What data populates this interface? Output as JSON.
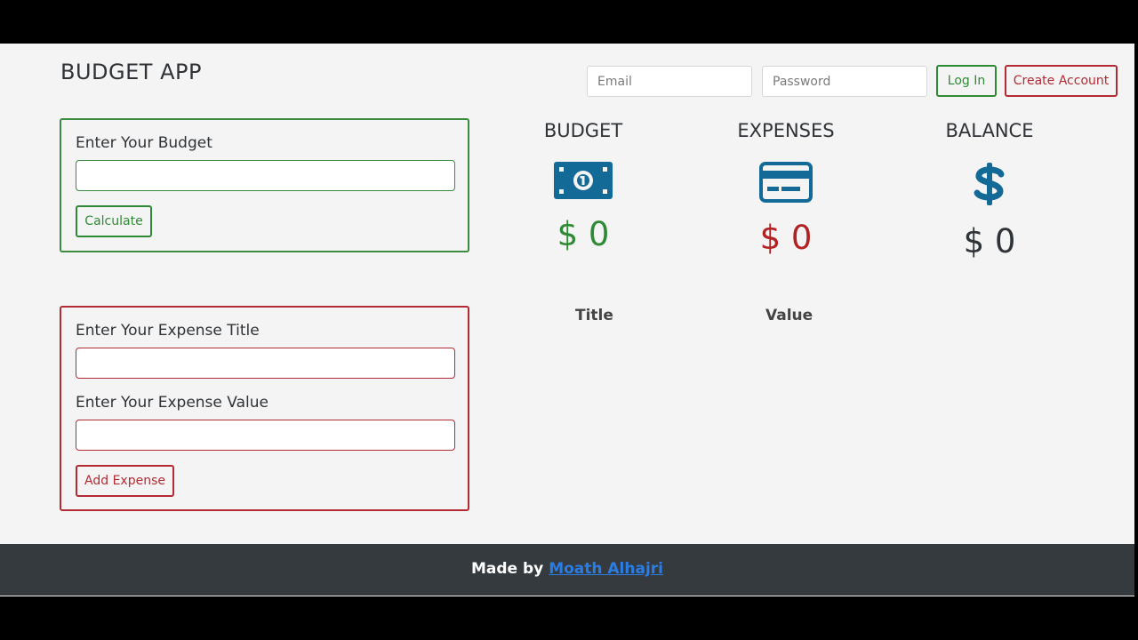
{
  "app": {
    "title": "BUDGET APP"
  },
  "auth": {
    "email_placeholder": "Email",
    "password_placeholder": "Password",
    "login_label": "Log In",
    "create_account_label": "Create Account"
  },
  "budget_form": {
    "label": "Enter Your Budget",
    "value": "",
    "button_label": "Calculate"
  },
  "expense_form": {
    "title_label": "Enter Your Expense Title",
    "title_value": "",
    "value_label": "Enter Your Expense Value",
    "value_value": "",
    "button_label": "Add Expense"
  },
  "stats": [
    {
      "heading": "BUDGET",
      "icon": "money-bill-icon",
      "value": "$ 0",
      "color": "#2f8a35"
    },
    {
      "heading": "EXPENSES",
      "icon": "credit-card-icon",
      "value": "$ 0",
      "color": "#b22222"
    },
    {
      "heading": "BALANCE",
      "icon": "dollar-sign-icon",
      "value": "$ 0",
      "color": "#2f3337"
    }
  ],
  "expense_list": {
    "columns": [
      "Title",
      "Value"
    ],
    "rows": []
  },
  "footer": {
    "prefix": "Made by",
    "author_link": "Moath Alhajri"
  },
  "colors": {
    "accent_green": "#2f8a35",
    "accent_red": "#b22a34",
    "icon_blue": "#146a96",
    "footer_bg": "#353a3f"
  }
}
